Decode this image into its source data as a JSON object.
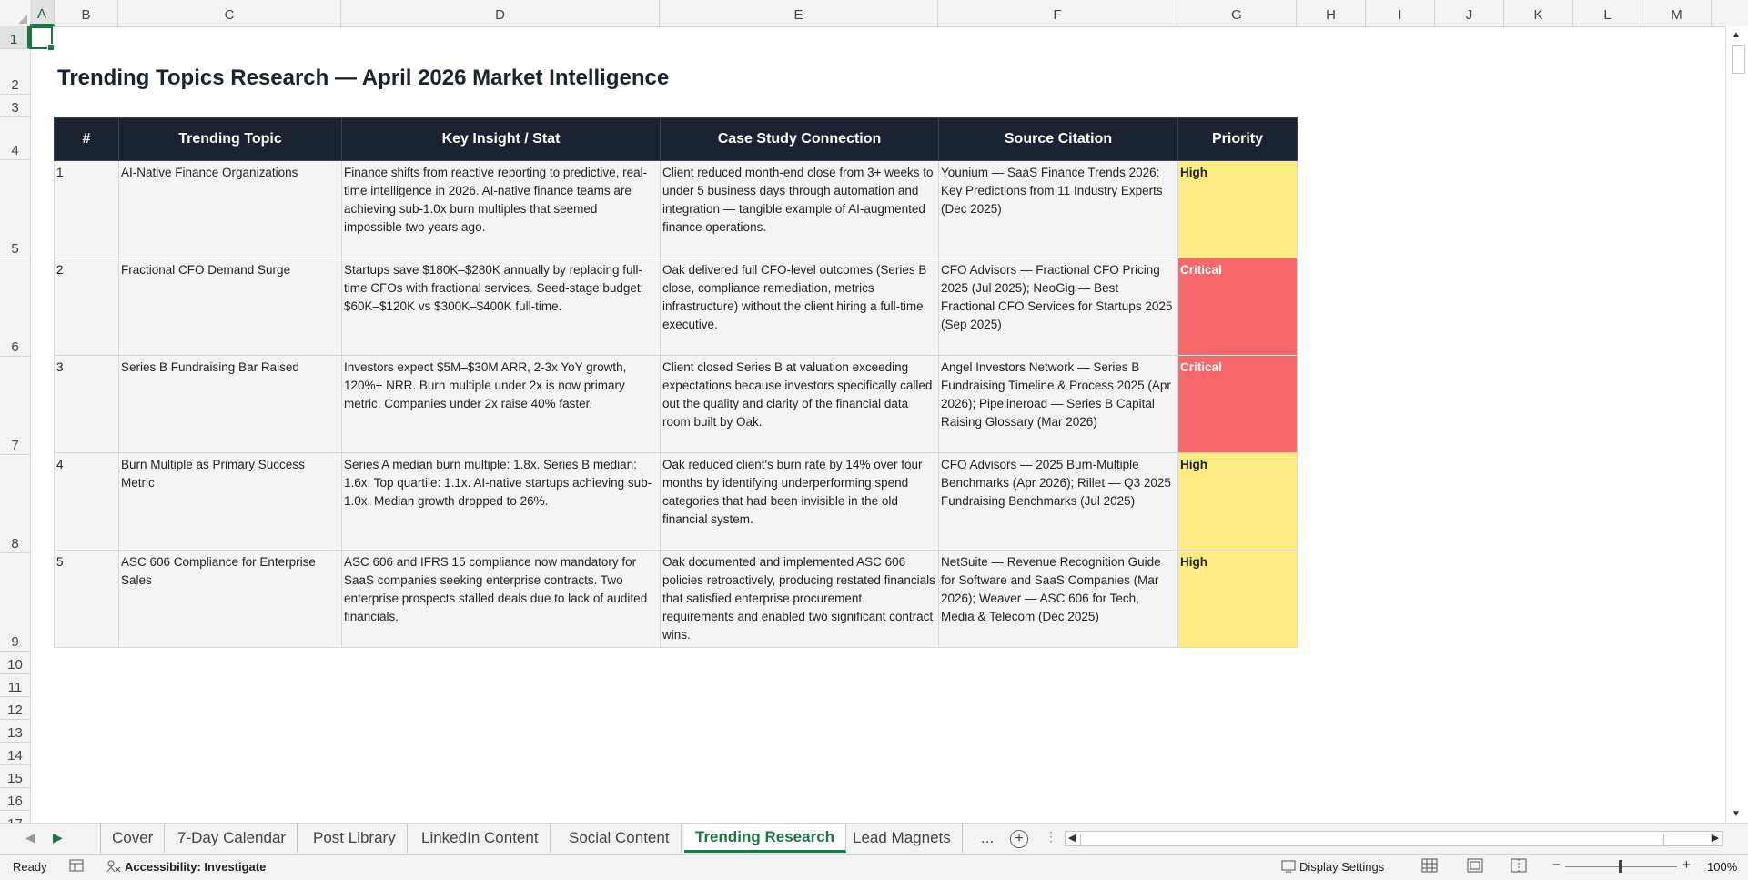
{
  "columns": [
    "A",
    "B",
    "C",
    "D",
    "E",
    "F",
    "G",
    "H",
    "I",
    "J",
    "K",
    "L",
    "M"
  ],
  "rows": [
    "1",
    "2",
    "3",
    "4",
    "5",
    "6",
    "7",
    "8",
    "9",
    "10",
    "11",
    "12",
    "13",
    "14",
    "15",
    "16",
    "17"
  ],
  "sheet_title": "Trending Topics Research — April 2026 Market Intelligence",
  "table": {
    "headers": [
      "#",
      "Trending Topic",
      "Key Insight / Stat",
      "Case Study Connection",
      "Source Citation",
      "Priority"
    ],
    "rows": [
      {
        "num": "1",
        "topic": "AI-Native Finance Organizations",
        "insight": "Finance shifts from reactive reporting to predictive, real-time intelligence in 2026. AI-native finance teams are achieving sub-1.0x burn multiples that seemed impossible two years ago.",
        "case": "Client reduced month-end close from 3+ weeks to under 5 business days through automation and integration — tangible example of AI-augmented finance operations.",
        "source": "Younium — SaaS Finance Trends 2026: Key Predictions from 11 Industry Experts (Dec 2025)",
        "priority": "High"
      },
      {
        "num": "2",
        "topic": "Fractional CFO Demand Surge",
        "insight": "Startups save $180K–$280K annually by replacing full-time CFOs with fractional services. Seed-stage budget: $60K–$120K vs $300K–$400K full-time.",
        "case": "Oak delivered full CFO-level outcomes (Series B close, compliance remediation, metrics infrastructure) without the client hiring a full-time executive.",
        "source": "CFO Advisors — Fractional CFO Pricing 2025 (Jul 2025); NeoGig — Best Fractional CFO Services for Startups 2025 (Sep 2025)",
        "priority": "Critical"
      },
      {
        "num": "3",
        "topic": "Series B Fundraising Bar Raised",
        "insight": "Investors expect $5M–$30M ARR, 2-3x YoY growth, 120%+ NRR. Burn multiple under 2x is now primary metric. Companies under 2x raise 40% faster.",
        "case": "Client closed Series B at valuation exceeding expectations because investors specifically called out the quality and clarity of the financial data room built by Oak.",
        "source": "Angel Investors Network — Series B Fundraising Timeline & Process 2025 (Apr 2026); Pipelineroad — Series B Capital Raising Glossary (Mar 2026)",
        "priority": "Critical"
      },
      {
        "num": "4",
        "topic": "Burn Multiple as Primary Success Metric",
        "insight": "Series A median burn multiple: 1.8x. Series B median: 1.6x. Top quartile: 1.1x. AI-native startups achieving sub-1.0x. Median growth dropped to 26%.",
        "case": "Oak reduced client's burn rate by 14% over four months by identifying underperforming spend categories that had been invisible in the old financial system.",
        "source": "CFO Advisors — 2025 Burn-Multiple Benchmarks (Apr 2026); Rillet — Q3 2025 Fundraising Benchmarks (Jul 2025)",
        "priority": "High"
      },
      {
        "num": "5",
        "topic": "ASC 606 Compliance for Enterprise Sales",
        "insight": "ASC 606 and IFRS 15 compliance now mandatory for SaaS companies seeking enterprise contracts. Two enterprise prospects stalled deals due to lack of audited financials.",
        "case": "Oak documented and implemented ASC 606 policies retroactively, producing restated financials that satisfied enterprise procurement requirements and enabled two significant contract wins.",
        "source": "NetSuite — Revenue Recognition Guide for Software and SaaS Companies (Mar 2026); Weaver — ASC 606 for Tech, Media & Telecom (Dec 2025)",
        "priority": "High"
      }
    ]
  },
  "priority_colors": {
    "High": "#ffeb84",
    "Critical": "#f8696b"
  },
  "priority_text_colors": {
    "High": "#222222",
    "Critical": "#ffffff"
  },
  "tabs": [
    "Cover",
    "7-Day Calendar",
    "Post Library",
    "LinkedIn Content",
    "Social Content",
    "Trending Research",
    "Lead Magnets"
  ],
  "active_tab": "Trending Research",
  "more_tabs": "...",
  "add_sheet": "+",
  "status": {
    "ready": "Ready",
    "accessibility": "Accessibility: Investigate",
    "display_settings": "Display Settings",
    "zoom": "100%"
  }
}
